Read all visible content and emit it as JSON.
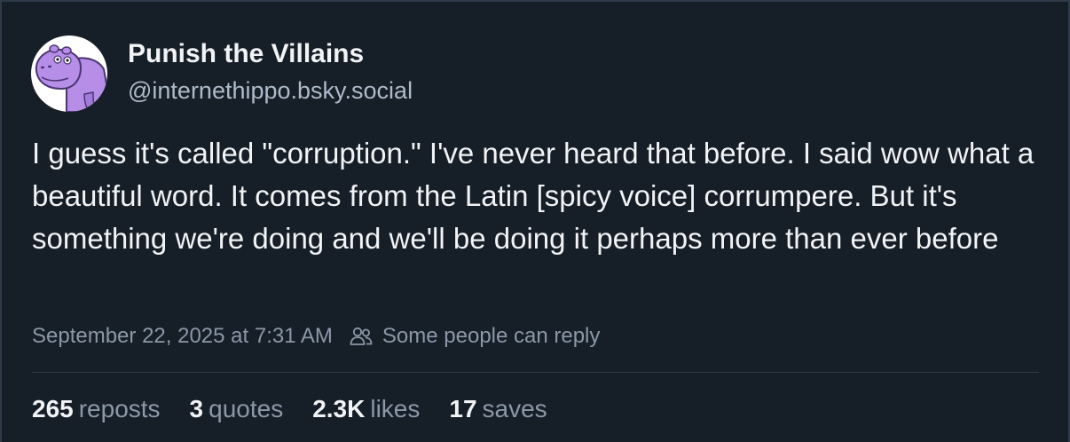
{
  "author": {
    "display_name": "Punish the Villains",
    "handle": "@internethippo.bsky.social",
    "avatar_icon": "purple-hippo-avatar"
  },
  "post": {
    "text": "I guess it's called \"corruption.\" I've never heard that before. I said wow what a beautiful word. It comes from the Latin [spicy voice] corrumpere. But it's something we're doing and we'll be doing it perhaps more than ever before",
    "timestamp": "September 22, 2025 at 7:31 AM",
    "reply_setting": "Some people can reply",
    "reply_setting_icon": "people-icon"
  },
  "stats": {
    "reposts": {
      "count": "265",
      "label": "reposts"
    },
    "quotes": {
      "count": "3",
      "label": "quotes"
    },
    "likes": {
      "count": "2.3K",
      "label": "likes"
    },
    "saves": {
      "count": "17",
      "label": "saves"
    }
  },
  "colors": {
    "background": "#161e27",
    "primary_text": "#f1f3f5",
    "secondary_text": "#8b98a8",
    "border": "#2e3a48",
    "avatar_hippo": "#b68ee8"
  }
}
